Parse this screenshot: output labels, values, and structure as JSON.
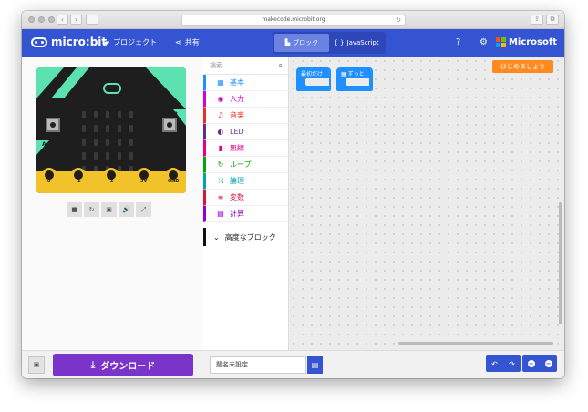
{
  "browser": {
    "url": "makecode.microbit.org",
    "reload_icon": "reload-icon"
  },
  "appbar": {
    "logo_text": "micro:bit",
    "project_label": "プロジェクト",
    "share_label": "共有",
    "tabs": [
      {
        "label": "ブロック",
        "active": true
      },
      {
        "label": "JavaScript",
        "active": false
      }
    ],
    "javascript_prefix": "{ }",
    "microsoft_label": "Microsoft",
    "ms_colors": [
      "#f25022",
      "#7fba00",
      "#00a4ef",
      "#ffb900"
    ],
    "accent": "#3454d1"
  },
  "simulator": {
    "pin_labels": [
      "0",
      "1",
      "2",
      "3V",
      "GND"
    ],
    "button_a": "A",
    "button_b": "B",
    "controls": [
      "stop-icon",
      "restart-icon",
      "debug-icon",
      "sound-icon",
      "fullscreen-icon"
    ],
    "control_glyphs": [
      "■",
      "↻",
      "▣",
      "🔊",
      "⤢"
    ]
  },
  "toolbox": {
    "search_placeholder": "検索...",
    "categories": [
      {
        "label": "基本",
        "color": "#1e90ff",
        "icon": "▦"
      },
      {
        "label": "入力",
        "color": "#d400d4",
        "icon": "◉"
      },
      {
        "label": "音楽",
        "color": "#e63022",
        "icon": "♫"
      },
      {
        "label": "LED",
        "color": "#5c2d91",
        "icon": "◐"
      },
      {
        "label": "無線",
        "color": "#e3008c",
        "icon": "▮"
      },
      {
        "label": "ループ",
        "color": "#00aa00",
        "icon": "↻"
      },
      {
        "label": "論理",
        "color": "#00a4a6",
        "icon": "⤨"
      },
      {
        "label": "変数",
        "color": "#dc143c",
        "icon": "≡"
      },
      {
        "label": "計算",
        "color": "#9400d3",
        "icon": "▤"
      }
    ],
    "advanced_label": "高度なブロック"
  },
  "workspace": {
    "get_started_label": "はじめましょう",
    "blocks": [
      {
        "label": "最初だけ"
      },
      {
        "label": "ずっと"
      }
    ]
  },
  "footer": {
    "download_label": "ダウンロード",
    "project_name": "題名未設定"
  }
}
